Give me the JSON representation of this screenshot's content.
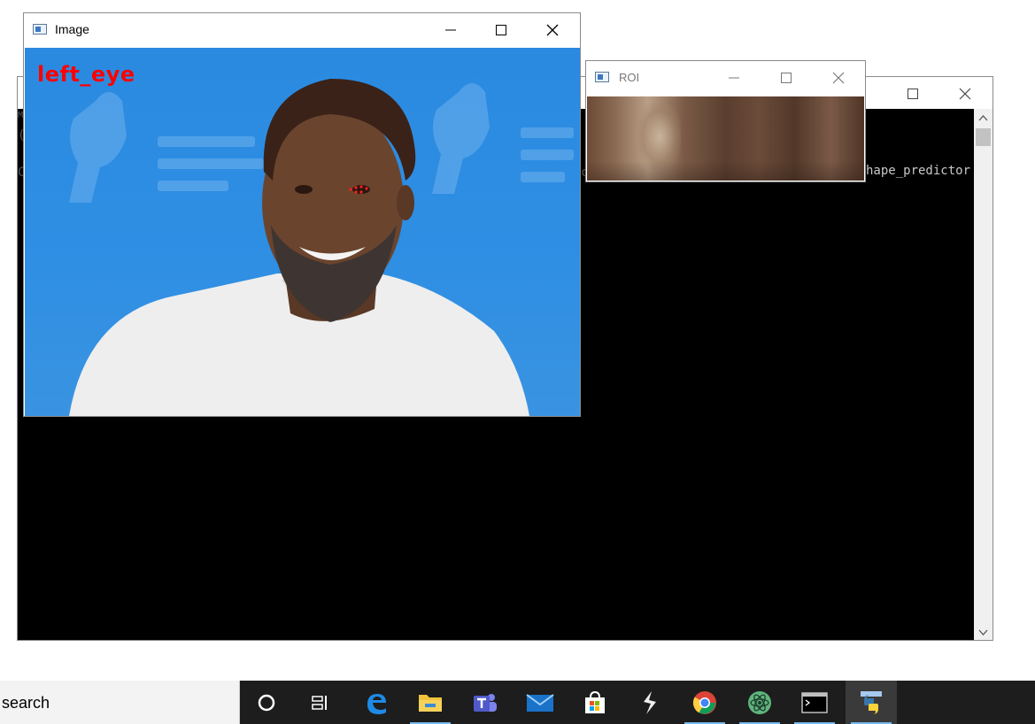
{
  "console": {
    "line1": "M",
    "line2": "(",
    "line3": "C",
    "visible_text": "hape_predictor",
    "hidden_text": "c"
  },
  "image_window": {
    "title": "Image",
    "overlay_label": "left_eye"
  },
  "roi_window": {
    "title": "ROI"
  },
  "taskbar": {
    "search_text": "search",
    "items": [
      {
        "name": "cortana",
        "icon": "circle-icon"
      },
      {
        "name": "task-view",
        "icon": "task-view-icon"
      },
      {
        "name": "edge",
        "icon": "edge-icon"
      },
      {
        "name": "file-explorer",
        "icon": "folder-icon"
      },
      {
        "name": "teams",
        "icon": "teams-icon"
      },
      {
        "name": "mail",
        "icon": "mail-icon"
      },
      {
        "name": "store",
        "icon": "store-icon"
      },
      {
        "name": "sublime",
        "icon": "sublime-icon"
      },
      {
        "name": "chrome",
        "icon": "chrome-icon"
      },
      {
        "name": "atom",
        "icon": "atom-icon"
      },
      {
        "name": "terminal",
        "icon": "terminal-icon"
      },
      {
        "name": "python",
        "icon": "python-icon"
      }
    ]
  },
  "colors": {
    "overlay_text": "#ff0000",
    "taskbar": "#1d1d1d",
    "indicator": "#76b9ed"
  }
}
